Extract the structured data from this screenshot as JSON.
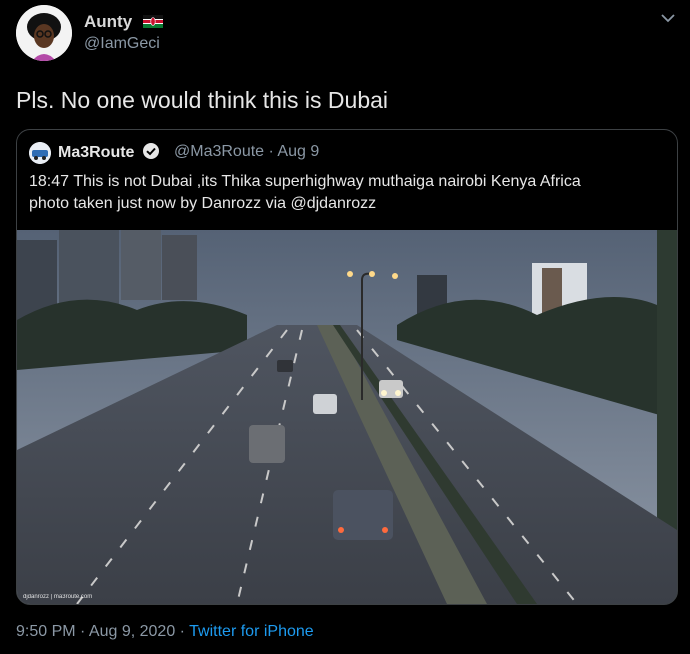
{
  "tweet": {
    "author": {
      "name": "Aunty",
      "handle": "@IamGeci",
      "flag_icon": "kenya-flag-icon"
    },
    "text": "Pls. No one would think this is Dubai",
    "quoted": {
      "name": "Ma3Route",
      "handle": "@Ma3Route · Aug 9",
      "text_line1": "18:47 This is not Dubai ,its Thika superhighway muthaiga nairobi Kenya Africa",
      "text_line2": "photo taken just now by Danrozz   via @djdanrozz",
      "watermark": "djdanrozz | ma3route.com"
    },
    "timestamp": "9:50 PM · Aug 9, 2020 · ",
    "source": "Twitter for iPhone"
  },
  "colors": {
    "background": "#000000",
    "link": "#1d9bf0",
    "muted": "#8b98a5",
    "border": "#3d4144"
  }
}
